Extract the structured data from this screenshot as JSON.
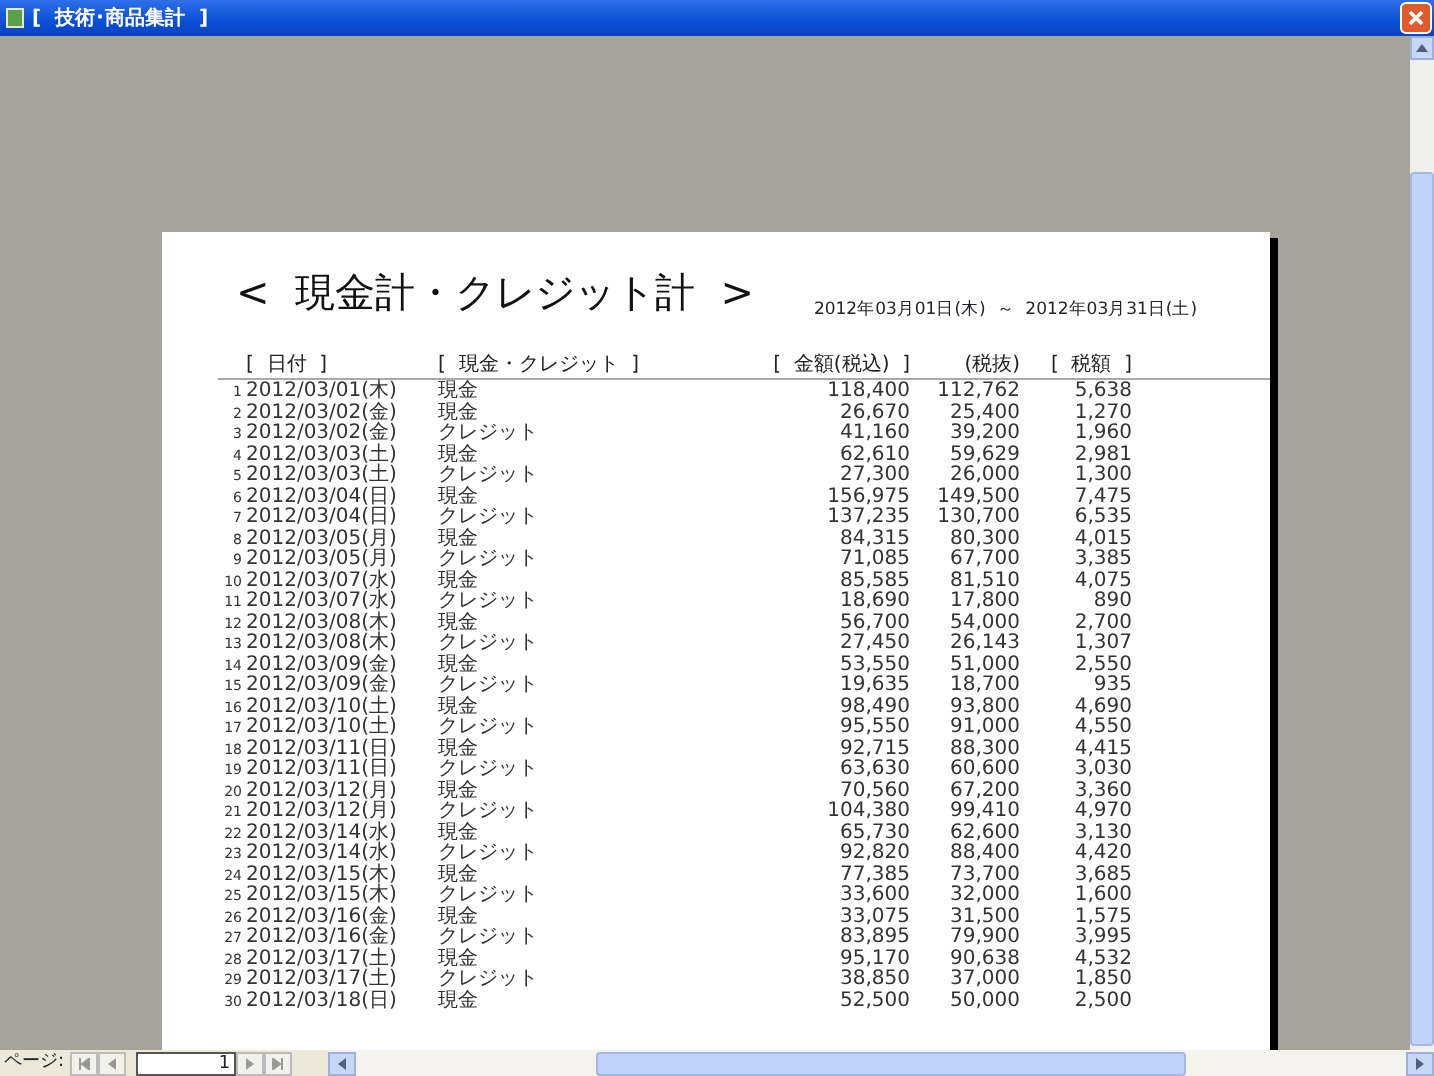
{
  "window": {
    "title": "[  技術･商品集計  ]"
  },
  "report": {
    "title": "<  現金計・クレジット計  >",
    "date_range": "2012年03月01日(木)  ～  2012年03月31日(土)",
    "columns": [
      "[  日付  ]",
      "[  現金・クレジット  ]",
      "[  金額(税込)  ]",
      "(税抜)",
      "[  税額  ]"
    ],
    "rows": [
      {
        "no": "1",
        "date": "2012/03/01(木)",
        "type": "現金",
        "amount": "118,400",
        "net": "112,762",
        "tax": "5,638"
      },
      {
        "no": "2",
        "date": "2012/03/02(金)",
        "type": "現金",
        "amount": "26,670",
        "net": "25,400",
        "tax": "1,270"
      },
      {
        "no": "3",
        "date": "2012/03/02(金)",
        "type": "クレジット",
        "amount": "41,160",
        "net": "39,200",
        "tax": "1,960"
      },
      {
        "no": "4",
        "date": "2012/03/03(土)",
        "type": "現金",
        "amount": "62,610",
        "net": "59,629",
        "tax": "2,981"
      },
      {
        "no": "5",
        "date": "2012/03/03(土)",
        "type": "クレジット",
        "amount": "27,300",
        "net": "26,000",
        "tax": "1,300"
      },
      {
        "no": "6",
        "date": "2012/03/04(日)",
        "type": "現金",
        "amount": "156,975",
        "net": "149,500",
        "tax": "7,475"
      },
      {
        "no": "7",
        "date": "2012/03/04(日)",
        "type": "クレジット",
        "amount": "137,235",
        "net": "130,700",
        "tax": "6,535"
      },
      {
        "no": "8",
        "date": "2012/03/05(月)",
        "type": "現金",
        "amount": "84,315",
        "net": "80,300",
        "tax": "4,015"
      },
      {
        "no": "9",
        "date": "2012/03/05(月)",
        "type": "クレジット",
        "amount": "71,085",
        "net": "67,700",
        "tax": "3,385"
      },
      {
        "no": "10",
        "date": "2012/03/07(水)",
        "type": "現金",
        "amount": "85,585",
        "net": "81,510",
        "tax": "4,075"
      },
      {
        "no": "11",
        "date": "2012/03/07(水)",
        "type": "クレジット",
        "amount": "18,690",
        "net": "17,800",
        "tax": "890"
      },
      {
        "no": "12",
        "date": "2012/03/08(木)",
        "type": "現金",
        "amount": "56,700",
        "net": "54,000",
        "tax": "2,700"
      },
      {
        "no": "13",
        "date": "2012/03/08(木)",
        "type": "クレジット",
        "amount": "27,450",
        "net": "26,143",
        "tax": "1,307"
      },
      {
        "no": "14",
        "date": "2012/03/09(金)",
        "type": "現金",
        "amount": "53,550",
        "net": "51,000",
        "tax": "2,550"
      },
      {
        "no": "15",
        "date": "2012/03/09(金)",
        "type": "クレジット",
        "amount": "19,635",
        "net": "18,700",
        "tax": "935"
      },
      {
        "no": "16",
        "date": "2012/03/10(土)",
        "type": "現金",
        "amount": "98,490",
        "net": "93,800",
        "tax": "4,690"
      },
      {
        "no": "17",
        "date": "2012/03/10(土)",
        "type": "クレジット",
        "amount": "95,550",
        "net": "91,000",
        "tax": "4,550"
      },
      {
        "no": "18",
        "date": "2012/03/11(日)",
        "type": "現金",
        "amount": "92,715",
        "net": "88,300",
        "tax": "4,415"
      },
      {
        "no": "19",
        "date": "2012/03/11(日)",
        "type": "クレジット",
        "amount": "63,630",
        "net": "60,600",
        "tax": "3,030"
      },
      {
        "no": "20",
        "date": "2012/03/12(月)",
        "type": "現金",
        "amount": "70,560",
        "net": "67,200",
        "tax": "3,360"
      },
      {
        "no": "21",
        "date": "2012/03/12(月)",
        "type": "クレジット",
        "amount": "104,380",
        "net": "99,410",
        "tax": "4,970"
      },
      {
        "no": "22",
        "date": "2012/03/14(水)",
        "type": "現金",
        "amount": "65,730",
        "net": "62,600",
        "tax": "3,130"
      },
      {
        "no": "23",
        "date": "2012/03/14(水)",
        "type": "クレジット",
        "amount": "92,820",
        "net": "88,400",
        "tax": "4,420"
      },
      {
        "no": "24",
        "date": "2012/03/15(木)",
        "type": "現金",
        "amount": "77,385",
        "net": "73,700",
        "tax": "3,685"
      },
      {
        "no": "25",
        "date": "2012/03/15(木)",
        "type": "クレジット",
        "amount": "33,600",
        "net": "32,000",
        "tax": "1,600"
      },
      {
        "no": "26",
        "date": "2012/03/16(金)",
        "type": "現金",
        "amount": "33,075",
        "net": "31,500",
        "tax": "1,575"
      },
      {
        "no": "27",
        "date": "2012/03/16(金)",
        "type": "クレジット",
        "amount": "83,895",
        "net": "79,900",
        "tax": "3,995"
      },
      {
        "no": "28",
        "date": "2012/03/17(土)",
        "type": "現金",
        "amount": "95,170",
        "net": "90,638",
        "tax": "4,532"
      },
      {
        "no": "29",
        "date": "2012/03/17(土)",
        "type": "クレジット",
        "amount": "38,850",
        "net": "37,000",
        "tax": "1,850"
      },
      {
        "no": "30",
        "date": "2012/03/18(日)",
        "type": "現金",
        "amount": "52,500",
        "net": "50,000",
        "tax": "2,500"
      }
    ]
  },
  "footer": {
    "page_label": "ページ:",
    "page_value": "1"
  }
}
